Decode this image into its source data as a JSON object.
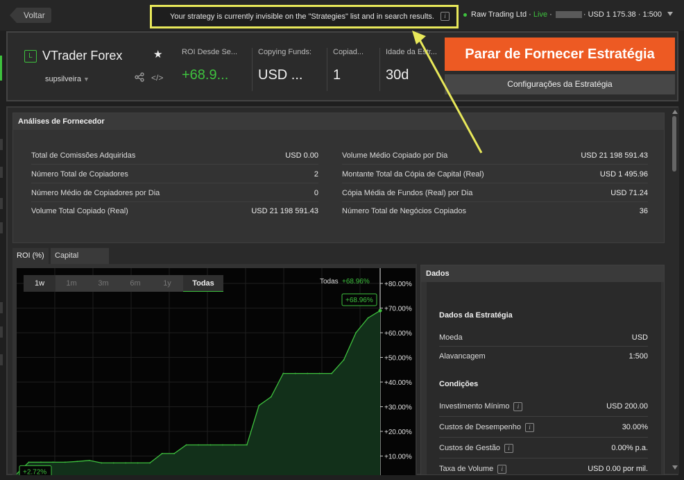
{
  "topbar": {
    "back_label": "Voltar",
    "notice": "Your strategy is currently invisible on the \"Strategies\" list and in search results.",
    "account_name": "Raw Trading Ltd",
    "account_sep": " · ",
    "account_status": "Live",
    "account_tail": "· USD 1 175.38 · 1:500",
    "colors": {
      "live": "#3ec23e",
      "highlight": "#e8e85a"
    }
  },
  "header": {
    "badge": "L",
    "strategy_name": "VTrader Forex",
    "provider": "supsilveira",
    "stats": [
      {
        "label": "ROI Desde Se...",
        "value": "+68.9..."
      },
      {
        "label": "Copying Funds:",
        "value": "USD ..."
      },
      {
        "label": "Copiad...",
        "value": "1"
      },
      {
        "label": "Idade da Estr...",
        "value": "30d"
      }
    ],
    "stop_button": "Parar de Fornecer Estratégia",
    "config_button": "Configurações da Estratégia",
    "colors": {
      "accent": "#ed5a23",
      "positive": "#3ec23e"
    }
  },
  "analytics": {
    "title": "Análises de Fornecedor",
    "left": [
      {
        "label": "Total de Comissões Adquiridas",
        "value": "USD 0.00"
      },
      {
        "label": "Número Total de Copiadores",
        "value": "2"
      },
      {
        "label": "Número Médio de Copiadores por Dia",
        "value": "0"
      },
      {
        "label": "Volume Total Copiado (Real)",
        "value": "USD 21 198 591.43"
      }
    ],
    "right": [
      {
        "label": "Volume Médio Copiado por Dia",
        "value": "USD 21 198 591.43"
      },
      {
        "label": "Montante Total da Cópia de Capital (Real)",
        "value": "USD 1 495.96"
      },
      {
        "label": "Cópia Média de Fundos (Real) por Dia",
        "value": "USD 71.24"
      },
      {
        "label": "Número Total de Negócios Copiados",
        "value": "36"
      }
    ]
  },
  "tabs": [
    "ROI (%)",
    "Capital Próprio"
  ],
  "chart": {
    "ranges": [
      "1w",
      "1m",
      "3m",
      "6m",
      "1y",
      "Todas"
    ],
    "legend_label": "Todas",
    "legend_value": "+68.96%",
    "end_label": "+68.96%",
    "start_label": "+2.72%"
  },
  "chart_data": {
    "type": "area",
    "y_ticks": [
      "+80.00%",
      "+70.00%",
      "+60.00%",
      "+50.00%",
      "+40.00%",
      "+30.00%",
      "+20.00%",
      "+10.00%"
    ],
    "ylim": [
      0,
      80
    ],
    "x": [
      0,
      1,
      2,
      3,
      4,
      5,
      6,
      7,
      8,
      9,
      10,
      11,
      12,
      13,
      14,
      15,
      16,
      17,
      18,
      19,
      20,
      21,
      22,
      23,
      24,
      25,
      26,
      27,
      28,
      29,
      30
    ],
    "values": [
      2.72,
      7.5,
      7.5,
      7.5,
      7.5,
      7.8,
      8.2,
      7.2,
      7.2,
      7.2,
      7.2,
      7.2,
      11,
      11,
      14.5,
      14.5,
      14.5,
      14.5,
      14.5,
      14.5,
      30.5,
      34,
      43.5,
      43.5,
      43.5,
      43.5,
      43.5,
      49,
      60,
      66,
      68.96
    ],
    "series": [
      {
        "name": "Todas"
      }
    ],
    "grid": true,
    "color": "#3ec23e"
  },
  "data_panel": {
    "title": "Dados",
    "strategy_section": "Dados da Estratégia",
    "strategy_rows": [
      {
        "label": "Moeda",
        "value": "USD"
      },
      {
        "label": "Alavancagem",
        "value": "1:500"
      }
    ],
    "conditions_section": "Condições",
    "conditions_rows": [
      {
        "label": "Investimento Mínimo",
        "value": "USD 200.00"
      },
      {
        "label": "Custos de Desempenho",
        "value": "30.00%"
      },
      {
        "label": "Custos de Gestão",
        "value": "0.00% p.a."
      },
      {
        "label": "Taxa de Volume",
        "value": "USD 0.00 por mil."
      }
    ]
  }
}
